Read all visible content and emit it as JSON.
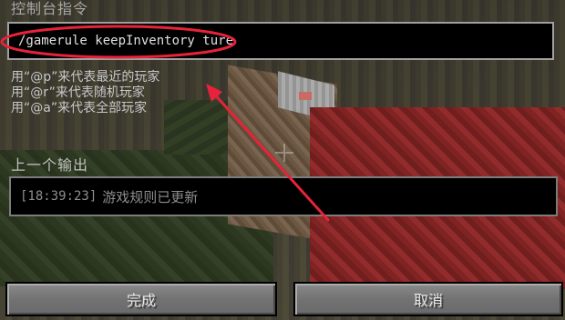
{
  "window": {
    "title": "控制台指令"
  },
  "command": {
    "value": "/gamerule keepInventory ture"
  },
  "hints": [
    "用“@p”来代表最近的玩家",
    "用“@r”来代表随机玩家",
    "用“@a”来代表全部玩家"
  ],
  "output": {
    "label": "上一个输出",
    "timestamp": "[18:39:23]",
    "message": "游戏规则已更新"
  },
  "buttons": {
    "done_label": "完成",
    "cancel_label": "取消"
  },
  "colors": {
    "annotation": "#e8223a",
    "red_block": "#b23636"
  }
}
